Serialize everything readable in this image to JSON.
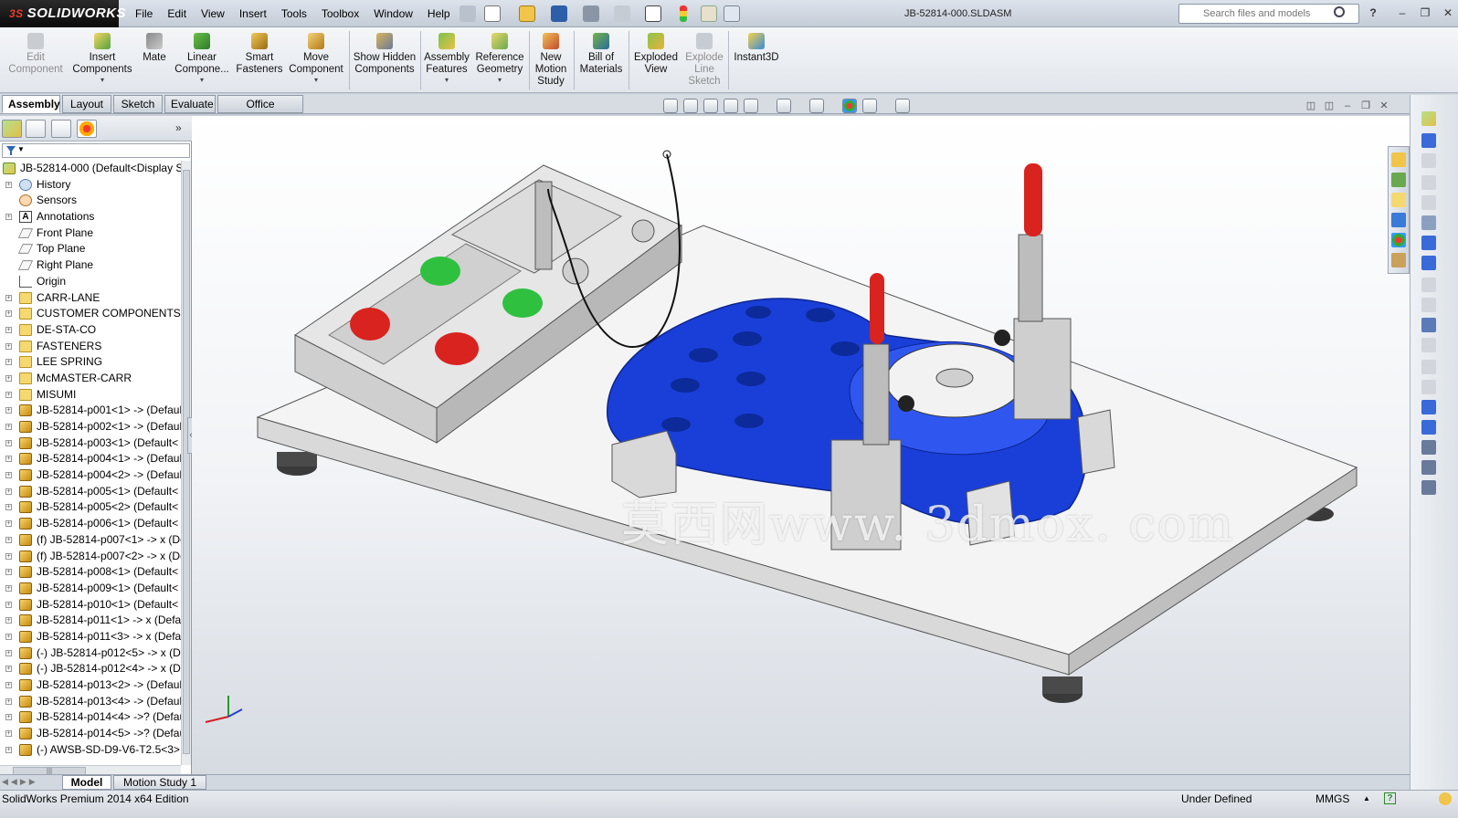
{
  "app": {
    "brand": "SOLIDWORKS",
    "brand_mark": "3S",
    "document_title": "JB-52814-000.SLDASM"
  },
  "menu": [
    "File",
    "Edit",
    "View",
    "Insert",
    "Tools",
    "Toolbox",
    "Window",
    "Help"
  ],
  "search": {
    "placeholder": "Search files and models"
  },
  "commands": [
    {
      "label": "Edit Component",
      "disabled": true,
      "dropdown": false
    },
    {
      "label": "Insert Components",
      "disabled": false,
      "dropdown": true
    },
    {
      "label": "Mate",
      "disabled": false,
      "dropdown": false
    },
    {
      "label": "Linear Compone...",
      "disabled": false,
      "dropdown": true
    },
    {
      "label": "Smart Fasteners",
      "disabled": false,
      "dropdown": false
    },
    {
      "label": "Move Component",
      "disabled": false,
      "dropdown": true
    },
    {
      "label": "Show Hidden Components",
      "disabled": false,
      "dropdown": false
    },
    {
      "label": "Assembly Features",
      "disabled": false,
      "dropdown": true
    },
    {
      "label": "Reference Geometry",
      "disabled": false,
      "dropdown": true
    },
    {
      "label": "New Motion Study",
      "disabled": false,
      "dropdown": false
    },
    {
      "label": "Bill of Materials",
      "disabled": false,
      "dropdown": false
    },
    {
      "label": "Exploded View",
      "disabled": false,
      "dropdown": false
    },
    {
      "label": "Explode Line Sketch",
      "disabled": true,
      "dropdown": false
    },
    {
      "label": "Instant3D",
      "disabled": false,
      "dropdown": false
    }
  ],
  "tabs": [
    "Assembly",
    "Layout",
    "Sketch",
    "Evaluate",
    "Office Products"
  ],
  "active_tab": "Assembly",
  "tree": {
    "root": "JB-52814-000  (Default<Display S",
    "items": [
      {
        "label": "History",
        "icon": "history-icon"
      },
      {
        "label": "Sensors",
        "icon": "sensors-icon"
      },
      {
        "label": "Annotations",
        "icon": "annotations-icon"
      },
      {
        "label": "Front Plane",
        "icon": "plane-icon"
      },
      {
        "label": "Top Plane",
        "icon": "plane-icon"
      },
      {
        "label": "Right Plane",
        "icon": "plane-icon"
      },
      {
        "label": "Origin",
        "icon": "origin-icon"
      },
      {
        "label": "CARR-LANE",
        "icon": "folder-icon"
      },
      {
        "label": "CUSTOMER COMPONENTS",
        "icon": "folder-icon"
      },
      {
        "label": "DE-STA-CO",
        "icon": "folder-icon"
      },
      {
        "label": "FASTENERS",
        "icon": "folder-icon"
      },
      {
        "label": "LEE SPRING",
        "icon": "folder-icon"
      },
      {
        "label": "McMASTER-CARR",
        "icon": "folder-icon"
      },
      {
        "label": "MISUMI",
        "icon": "folder-icon"
      },
      {
        "label": "JB-52814-p001<1> -> (Defaul",
        "icon": "part-icon"
      },
      {
        "label": "JB-52814-p002<1> -> (Defaul",
        "icon": "part-icon"
      },
      {
        "label": "JB-52814-p003<1> (Default<",
        "icon": "part-icon"
      },
      {
        "label": "JB-52814-p004<1> -> (Defaul",
        "icon": "part-icon"
      },
      {
        "label": "JB-52814-p004<2> -> (Defaul",
        "icon": "part-icon"
      },
      {
        "label": "JB-52814-p005<1> (Default<",
        "icon": "part-icon"
      },
      {
        "label": "JB-52814-p005<2> (Default<",
        "icon": "part-icon"
      },
      {
        "label": "JB-52814-p006<1> (Default<",
        "icon": "part-icon"
      },
      {
        "label": "(f) JB-52814-p007<1> -> x (De",
        "icon": "part-icon"
      },
      {
        "label": "(f) JB-52814-p007<2> -> x (De",
        "icon": "part-icon"
      },
      {
        "label": "JB-52814-p008<1> (Default<",
        "icon": "part-icon"
      },
      {
        "label": "JB-52814-p009<1> (Default<",
        "icon": "part-icon"
      },
      {
        "label": "JB-52814-p010<1> (Default<",
        "icon": "part-icon"
      },
      {
        "label": "JB-52814-p011<1> -> x (Defau",
        "icon": "part-icon"
      },
      {
        "label": "JB-52814-p011<3> -> x (Defau",
        "icon": "part-icon"
      },
      {
        "label": "(-) JB-52814-p012<5> -> x (De",
        "icon": "part-icon"
      },
      {
        "label": "(-) JB-52814-p012<4> -> x (De",
        "icon": "part-icon"
      },
      {
        "label": "JB-52814-p013<2> -> (Defaul",
        "icon": "part-icon"
      },
      {
        "label": "JB-52814-p013<4> -> (Defaul",
        "icon": "part-icon"
      },
      {
        "label": "JB-52814-p014<4> ->? (Defau",
        "icon": "part-icon"
      },
      {
        "label": "JB-52814-p014<5> ->? (Defau",
        "icon": "part-icon"
      },
      {
        "label": "(-) AWSB-SD-D9-V6-T2.5<3>",
        "icon": "part-icon"
      }
    ]
  },
  "bottom_tabs": [
    "Model",
    "Motion Study 1"
  ],
  "status": {
    "edition": "SolidWorks Premium 2014 x64 Edition",
    "state": "Under Defined",
    "units": "MMGS"
  },
  "watermark": "莫西网www. 3dmox. com",
  "colors": {
    "fixture_blue": "#1a3fd8",
    "clamp_handle_red": "#d8231f",
    "indicator_green": "#2fc040",
    "baseplate": "#f2f2f2"
  }
}
